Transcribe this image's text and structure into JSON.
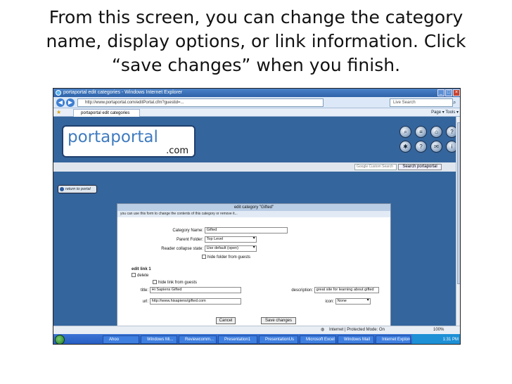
{
  "slide": {
    "title_line1": "From this screen, you can change the category",
    "title_line2": "name, display options, or link information.  Click",
    "title_line3": "“save changes” when you finish."
  },
  "browser": {
    "window_title": "portaportal edit categories - Windows Internet Explorer",
    "address": "http://www.portaportal.com/editPortal.cfm?guestid=...",
    "search_placeholder": "Live Search",
    "tab_label": "portaportal edit categories",
    "tools_text": "Page ▾  Tools ▾"
  },
  "site": {
    "logo_main": "portaportal",
    "logo_com": ".com",
    "search_input_placeholder": "Google Custom Search",
    "search_button": "Search portaportal",
    "return_button": "return to portal"
  },
  "edit": {
    "panel_title": "edit category \"Gifted\"",
    "panel_instructions": "you can use this form to change the contents of this category or remove it...",
    "category_name_label": "Category Name:",
    "category_name_value": "Gifted",
    "parent_label": "Parent Folder:",
    "parent_value": "Top Level",
    "collapse_label": "Reader collapse state:",
    "collapse_value": "Use default (open)",
    "hide_guests_label": "hide folder from guests",
    "edit_link_label": "edit link 1",
    "delete_label": "delete",
    "hide_link_label": "hide link from guests",
    "title_label": "title:",
    "title_value": "Hi Sapiens Gifted",
    "description_label": "description:",
    "description_value": "great site for learning about gifted",
    "url_label": "url:",
    "url_value": "http://www.hisapiens/gifted.com",
    "icon_label": "icon:",
    "icon_value": "None",
    "cancel_button": "Cancel",
    "save_button": "Save changes"
  },
  "status": {
    "internet_zone": "Internet | Protected Mode: On",
    "zoom": "100%"
  },
  "taskbar": {
    "items": [
      "Ahoo",
      "Windows Mi...",
      "Reviewcomm...",
      "Presentation1",
      "PresentationUs",
      "Microsoft Excel",
      "Windows Mail",
      "Internet Explorer"
    ],
    "clock": "1:31 PM"
  }
}
